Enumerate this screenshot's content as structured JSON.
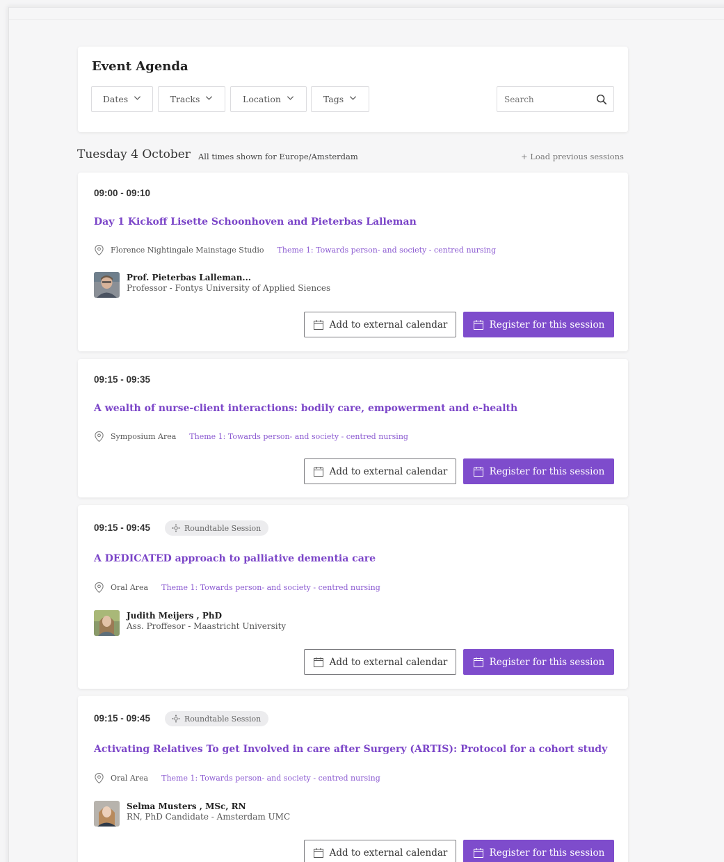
{
  "header": {
    "title": "Event Agenda",
    "filters": [
      {
        "label": "Dates"
      },
      {
        "label": "Tracks"
      },
      {
        "label": "Location"
      },
      {
        "label": "Tags"
      }
    ],
    "search_placeholder": "Search"
  },
  "day": {
    "title": "Tuesday 4 October",
    "timezone_note": "All times shown for Europe/Amsterdam",
    "load_previous": "+ Load previous sessions"
  },
  "buttons": {
    "add_calendar": "Add to external calendar",
    "register": "Register for this session"
  },
  "sessions": [
    {
      "time": "09:00 - 09:10",
      "tag": "",
      "title": "Day 1 Kickoff Lisette Schoonhoven and Pieterbas Lalleman",
      "location": "Florence Nightingale Mainstage Studio",
      "theme": "Theme 1: Towards person- and society - centred nursing",
      "speaker": {
        "name": "Prof. Pieterbas Lalleman...",
        "role": "Professor - Fontys University of Applied Siences"
      }
    },
    {
      "time": "09:15 - 09:35",
      "tag": "",
      "title": "A wealth of nurse-client interactions: bodily care, empowerment and e-health",
      "location": "Symposium Area",
      "theme": "Theme 1: Towards person- and society - centred nursing",
      "speaker": null
    },
    {
      "time": "09:15 - 09:45",
      "tag": "Roundtable Session",
      "title": "A DEDICATED approach to palliative dementia care",
      "location": "Oral Area",
      "theme": "Theme 1: Towards person- and society - centred nursing",
      "speaker": {
        "name": "Judith Meijers , PhD",
        "role": "Ass. Proffesor - Maastricht University"
      }
    },
    {
      "time": "09:15 - 09:45",
      "tag": "Roundtable Session",
      "title": "Activating Relatives To get Involved in care after Surgery (ARTIS): Protocol for a cohort study",
      "location": "Oral Area",
      "theme": "Theme 1: Towards person- and society - centred nursing",
      "speaker": {
        "name": "Selma Musters , MSc, RN",
        "role": "RN, PhD Candidate - Amsterdam UMC"
      }
    }
  ],
  "colors": {
    "accent": "#7e4ccc",
    "title": "#7b45c8",
    "theme_link": "#8b5ad1"
  }
}
